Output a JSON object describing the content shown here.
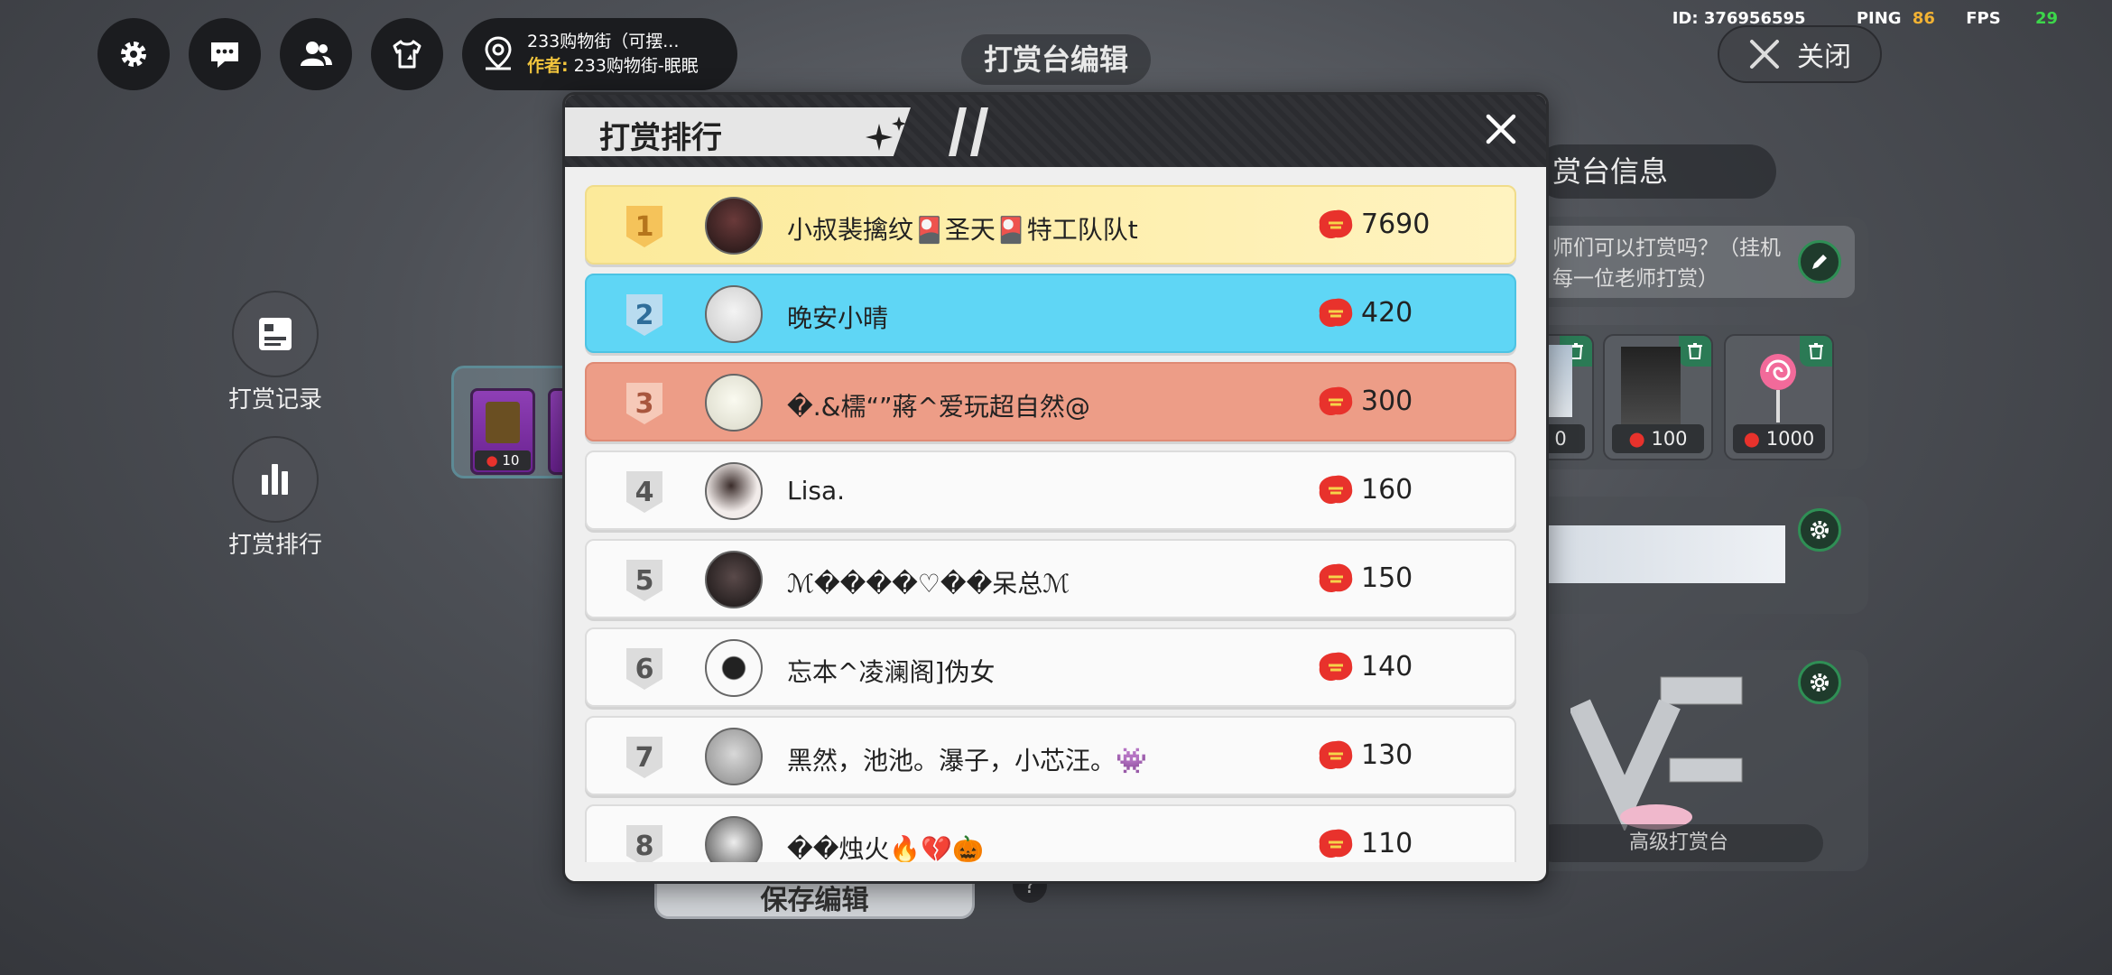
{
  "topbar": {
    "location_line1": "233购物街（可摆...",
    "author_key": "作者:",
    "author_value": "233购物街-眠眠",
    "page_title": "打赏台编辑",
    "id_text": "ID: 376956595",
    "ping_label": "PING",
    "ping_value": "86",
    "fps_label": "FPS",
    "fps_value": "29",
    "close_label": "关闭"
  },
  "side_tools": [
    {
      "label": "打赏记录",
      "icon": "record-icon"
    },
    {
      "label": "打赏排行",
      "icon": "bar-chart-icon"
    }
  ],
  "background": {
    "slot_price": "10",
    "right_header": "赏台信息",
    "desc_line1": "师们可以打赏吗？（挂机",
    "desc_line2": "每一位老师打赏）",
    "gift_prices": [
      "0",
      "100",
      "1000"
    ],
    "advanced_label": "高级打赏台",
    "save_label": "保存编辑",
    "help": "?"
  },
  "dialog": {
    "title": "打赏排行",
    "rows": [
      {
        "rank": "1",
        "name": "小叔裴擒纹🎴圣天🎴特工队队t",
        "amount": "7690"
      },
      {
        "rank": "2",
        "name": "晚安小晴",
        "amount": "420"
      },
      {
        "rank": "3",
        "name": "�.&檽“”蔣^爱玩超自然@",
        "amount": "300"
      },
      {
        "rank": "4",
        "name": "Lisa.",
        "amount": "160"
      },
      {
        "rank": "5",
        "name": "ℳ����♡��呆总ℳ",
        "amount": "150"
      },
      {
        "rank": "6",
        "name": "忘本^凌澜阁]伪女",
        "amount": "140"
      },
      {
        "rank": "7",
        "name": "黑然，池池。瀑子，小芯汪。👾",
        "amount": "130"
      },
      {
        "rank": "8",
        "name": "��烛火🔥💔🎃",
        "amount": "110"
      }
    ]
  },
  "colors": {
    "rank1": "#fcea9a",
    "rank2": "#5fd6f5",
    "rank3": "#ed9d87",
    "coin": "#e8322c",
    "accent_green": "#2f8f55"
  }
}
